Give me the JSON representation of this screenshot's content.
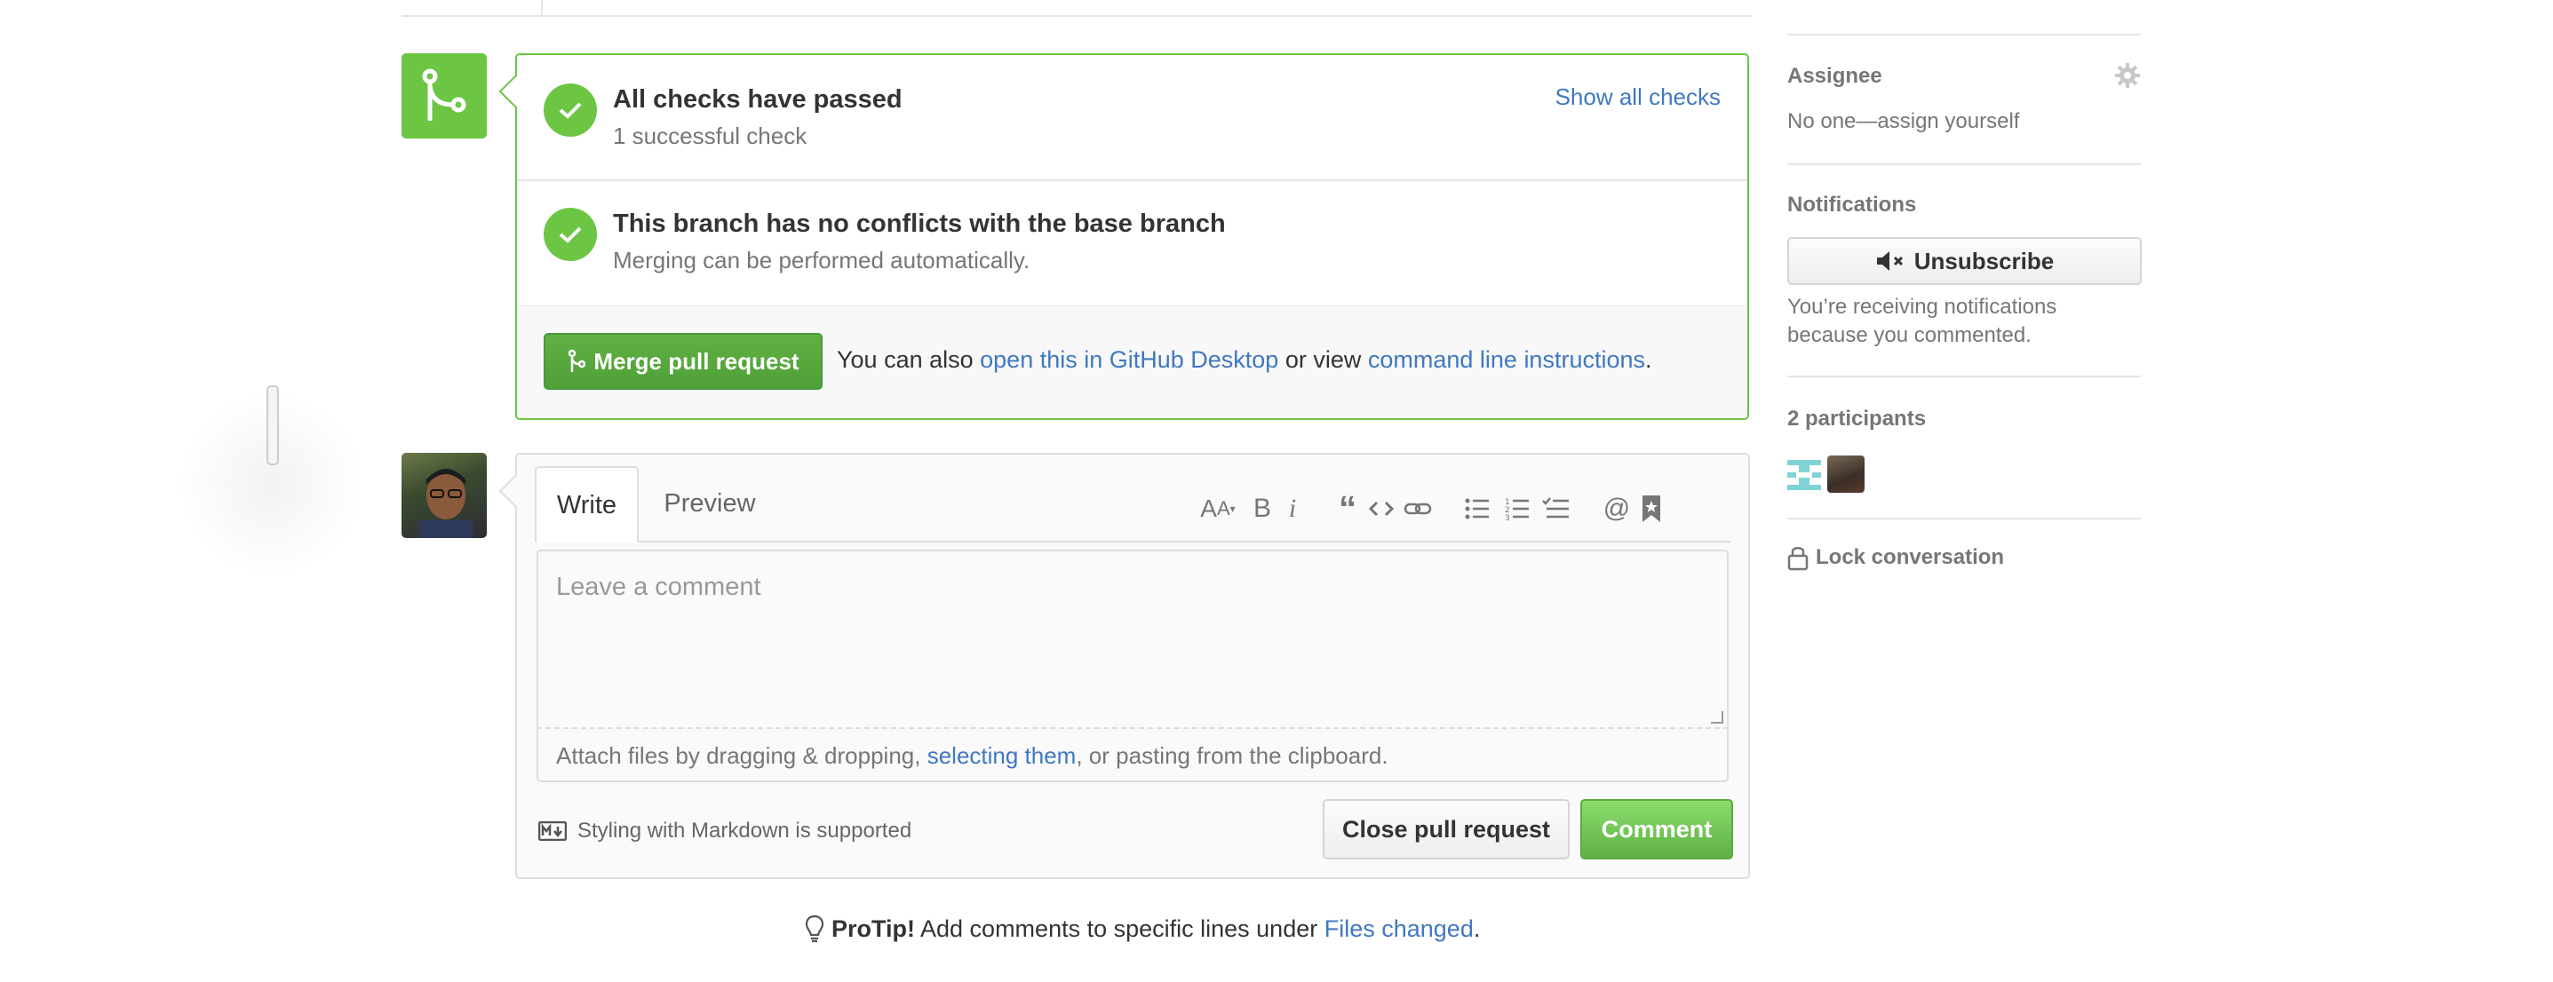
{
  "merge": {
    "checks_title": "All checks have passed",
    "checks_sub": "1 successful check",
    "show_all_checks": "Show all checks",
    "conflicts_title": "This branch has no conflicts with the base branch",
    "conflicts_sub": "Merging can be performed automatically.",
    "merge_button": "Merge pull request",
    "hint_prefix": "You can also ",
    "hint_desktop_link": "open this in GitHub Desktop",
    "hint_middle": " or view ",
    "hint_cli_link": "command line instructions",
    "hint_suffix": "."
  },
  "comment": {
    "tab_write": "Write",
    "tab_preview": "Preview",
    "placeholder": "Leave a comment",
    "attach_prefix": "Attach files by dragging & dropping, ",
    "attach_link": "selecting them",
    "attach_suffix": ", or pasting from the clipboard.",
    "markdown_note": "Styling with Markdown is supported",
    "close_button": "Close pull request",
    "comment_button": "Comment",
    "toolbar_icons": [
      "text-size-icon",
      "bold-icon",
      "italic-icon",
      "quote-icon",
      "code-icon",
      "link-icon",
      "bullet-list-icon",
      "numbered-list-icon",
      "task-list-icon",
      "mention-icon",
      "saved-reply-icon"
    ]
  },
  "protip": {
    "label": "ProTip!",
    "text": " Add comments to specific lines under ",
    "link": "Files changed",
    "suffix": "."
  },
  "sidebar": {
    "assignee_heading": "Assignee",
    "assignee_value": "No one—assign yourself",
    "notifications_heading": "Notifications",
    "unsubscribe_button": "Unsubscribe",
    "notifications_reason_line1": "You’re receiving notifications",
    "notifications_reason_line2": "because you commented.",
    "participants_heading": "2 participants",
    "lock_label": "Lock conversation"
  },
  "colors": {
    "success_green": "#6cc644",
    "link_blue": "#4078c0",
    "muted_text": "#767676"
  }
}
